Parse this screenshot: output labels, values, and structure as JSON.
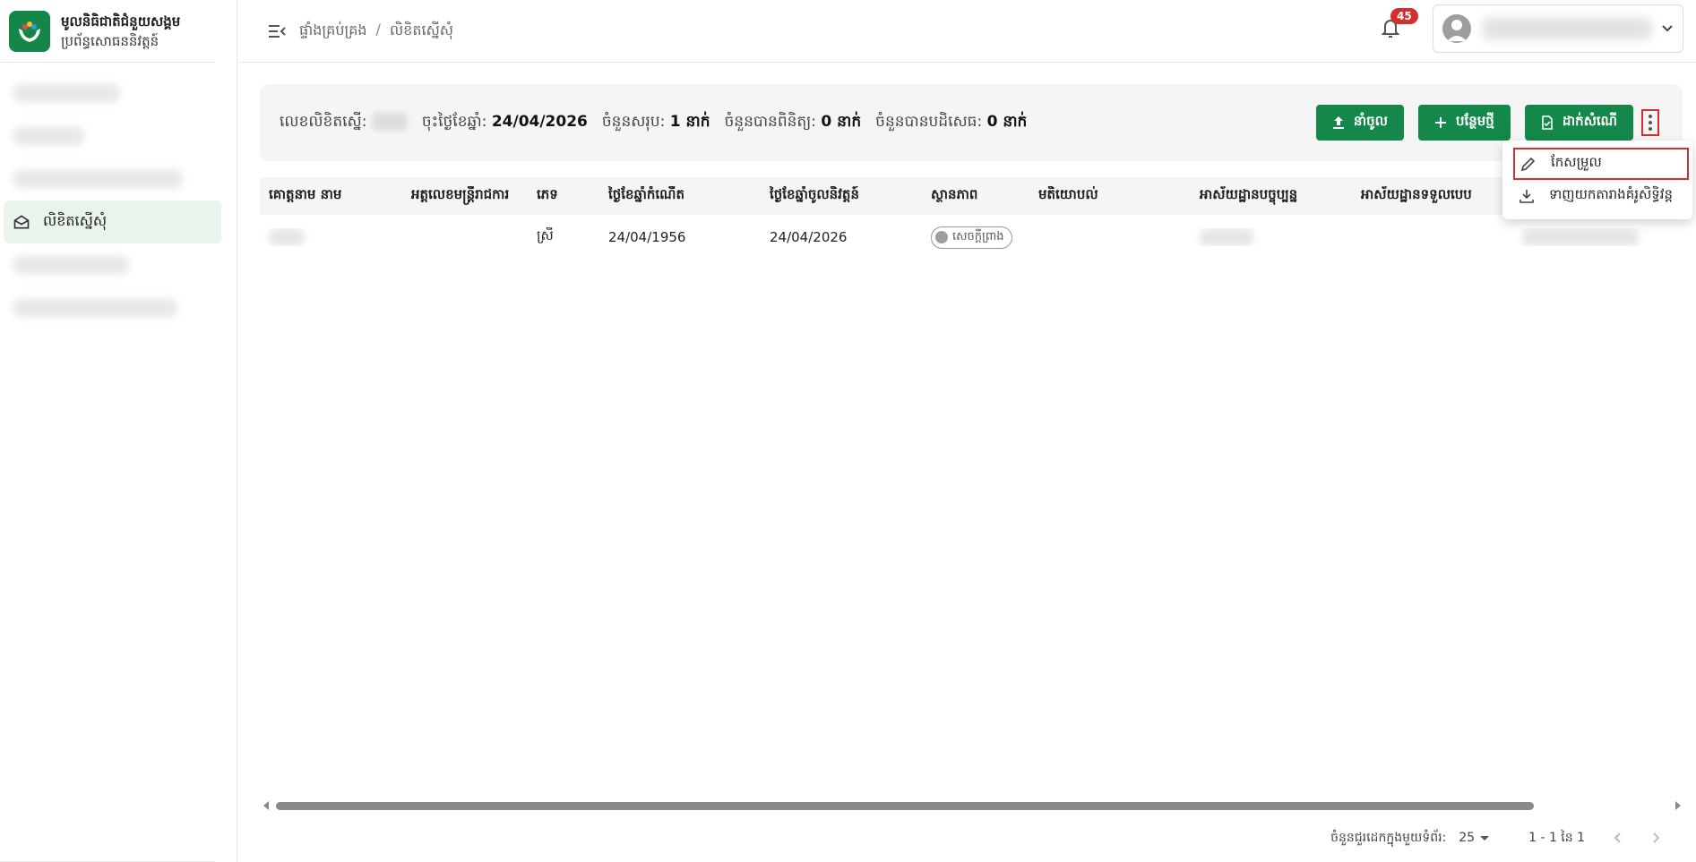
{
  "brand": {
    "title": "មូលនិធិជាតិជំនួយសង្គម",
    "subtitle": "ប្រព័ន្ធសោធននិវត្តន៍"
  },
  "sidebar": {
    "items": [
      {
        "label": "លិខិតស្នើសុំ",
        "active": true
      }
    ]
  },
  "topbar": {
    "breadcrumb": [
      "ផ្ទាំងគ្រប់គ្រង",
      "លិខិតស្នើសុំ"
    ],
    "breadcrumb_sep": "/",
    "notifications": "45"
  },
  "summary": {
    "doc_no_label": "លេខលិខិតស្នើ:",
    "date_label": "ចុះថ្ងៃខែឆ្នាំ:",
    "date_value": "24/04/2026",
    "total_label": "ចំនួនសរុប:",
    "total_value": "1 នាក់",
    "verified_label": "ចំនួនបានពិនិត្យ:",
    "verified_value": "0 នាក់",
    "rejected_label": "ចំនួនបានបដិសេធ:",
    "rejected_value": "0 នាក់"
  },
  "actions": {
    "import": "នាំចូល",
    "add": "បន្ថែមថ្មី",
    "submit": "ដាក់សំណើ"
  },
  "menu": {
    "edit": "កែសម្រួល",
    "download": "ទាញយកតារាងគំរូសិទ្ធិវន្ត"
  },
  "table": {
    "columns": [
      "គោត្តនាម នាម",
      "អត្តលេខមន្ត្រីរាជការ",
      "ភេទ",
      "ថ្ងៃខែឆ្នាំកំណើត",
      "ថ្ងៃខែឆ្នាំចូលនិវត្តន៍",
      "ស្ថានភាព",
      "មតិយោបល់",
      "អាស័យដ្ឋានបច្ចុប្បន្ន",
      "អាស័យដ្ឋានទទួលបេប"
    ],
    "rows": [
      {
        "gender": "ស្រី",
        "dob": "24/04/1956",
        "retire": "24/04/2026",
        "status": "សេចក្តីព្រាង"
      }
    ]
  },
  "pager": {
    "rows_label": "ចំនួនជួរដេកក្នុងមួយទំព័រ:",
    "page_size": "25",
    "range": "1 - 1 នៃ 1"
  }
}
